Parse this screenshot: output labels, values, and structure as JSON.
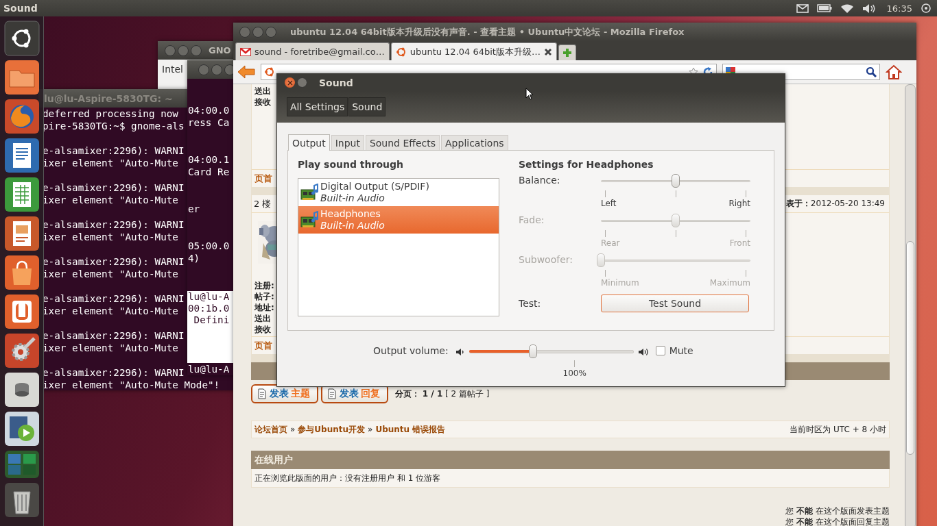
{
  "top_panel": {
    "app_title": "Sound",
    "clock": "16:35"
  },
  "launcher": [
    {
      "kind": "dash"
    },
    {
      "kind": "folder"
    },
    {
      "kind": "browser"
    },
    {
      "kind": "writer"
    },
    {
      "kind": "calc"
    },
    {
      "kind": "impress"
    },
    {
      "kind": "store"
    },
    {
      "kind": "cloud"
    },
    {
      "kind": "settings"
    },
    {
      "kind": "disk"
    },
    {
      "kind": "video"
    },
    {
      "kind": "workspaces"
    },
    {
      "kind": "trash"
    }
  ],
  "gnome_window": {
    "title": "GNO",
    "lines": [
      "Intel"
    ]
  },
  "terminal": {
    "title": "lu@lu-Aspire-5830TG: ~",
    "groups": [
      [
        "deferred processing now",
        "pire-5830TG:~$ gnome-als"
      ],
      [
        "e-alsamixer:2296): WARNI",
        "ixer element \"Auto-Mute"
      ],
      [
        "e-alsamixer:2296): WARNI",
        "ixer element \"Auto-Mute"
      ],
      [
        "e-alsamixer:2296): WARNI",
        "ixer element \"Auto-Mute"
      ],
      [
        "e-alsamixer:2296): WARNI",
        "ixer element \"Auto-Mute"
      ],
      [
        "e-alsamixer:2296): WARNI",
        "ixer element \"Auto-Mute"
      ],
      [
        "e-alsamixer:2296): WARNI",
        "ixer element \"Auto-Mute"
      ],
      [
        "e-alsamixer:2296): WARNI",
        "ixer element \"Auto-Mute Mode\"!"
      ]
    ]
  },
  "second_terminal": {
    "blocks": [
      {
        "kind": "dark",
        "groups": [
          [
            "04:00.0",
            "ress Ca"
          ],
          [
            "04:00.1",
            "Card Re"
          ],
          [
            "er"
          ],
          [
            "05:00.0",
            "4)"
          ]
        ]
      },
      {
        "kind": "light",
        "groups": [
          [
            "lu@lu-A",
            "00:1b.0",
            " Defini"
          ]
        ]
      },
      {
        "kind": "dark",
        "groups": [
          [
            "lu@lu-A"
          ]
        ]
      }
    ]
  },
  "browser": {
    "title": "ubuntu 12.04 64bit版本升级后没有声音. - 查看主题 • Ubuntu中文论坛 - Mozilla Firefox",
    "tabs": [
      {
        "label": "sound - foretribe@gmail.co…",
        "kind": "mail",
        "selected": false
      },
      {
        "label": "ubuntu 12.04 64bit版本升级…",
        "kind": "site",
        "selected": true
      }
    ],
    "search": {
      "kind": "web"
    }
  },
  "forum": {
    "post_top": {
      "labels": [
        "送出",
        "接收"
      ],
      "top_link": "页首"
    },
    "post": {
      "number": "2 楼",
      "posted": "**表于：**2012-05-20 13:49",
      "labels": [
        "注册:",
        "帖子:",
        "地址:",
        "送出",
        "接收"
      ],
      "top_link": "页首"
    },
    "actions": [
      {
        "lead": "发表",
        "accent": "主题"
      },
      {
        "lead": "发表",
        "accent": "回复"
      }
    ],
    "pagination": "**分页：** **1 / 1**  [ 2 篇帖子 ]",
    "breadcrumb": [
      {
        "kind": "link",
        "text": "论坛首页"
      },
      {
        "kind": "separator",
        "text": "»"
      },
      {
        "kind": "link",
        "text": "参与Ubuntu开发"
      },
      {
        "kind": "separator",
        "text": "»"
      },
      {
        "kind": "link",
        "text": "Ubuntu 错误报告"
      }
    ],
    "timezone": "当前时区为 UTC + 8 小时",
    "online": {
      "heading": "在线用户",
      "text": "正在浏览此版面的用户：没有注册用户 和 1 位游客"
    },
    "permissions": [
      "您 **不能** 在这个版面发表主题",
      "您 **不能** 在这个版面回复主题"
    ]
  },
  "sound_dialog": {
    "title": "Sound",
    "path": [
      "All Settings",
      "Sound"
    ],
    "tabs": [
      {
        "label": "Output",
        "selected": true
      },
      {
        "label": "Input",
        "selected": false
      },
      {
        "label": "Sound Effects",
        "selected": false
      },
      {
        "label": "Applications",
        "selected": false
      }
    ],
    "device_heading": "Play sound through",
    "devices": [
      {
        "name": "Digital Output (S/PDIF)",
        "detail": "Built-in Audio",
        "selected": false
      },
      {
        "name": "Headphones",
        "detail": "Built-in Audio",
        "selected": true
      }
    ],
    "settings_heading": "Settings for Headphones",
    "sliders": [
      {
        "label": "Balance:",
        "min_label": "Left",
        "max_label": "Right",
        "level": 0.5,
        "disabled": false,
        "center_tick": true
      },
      {
        "label": "Fade:",
        "min_label": "Rear",
        "max_label": "Front",
        "level": 0.5,
        "disabled": true,
        "center_tick": true
      },
      {
        "label": "Subwoofer:",
        "min_label": "Minimum",
        "max_label": "Maximum",
        "level": 0,
        "disabled": true,
        "center_tick": false
      }
    ],
    "test_label": "Test:",
    "test_button": "Test Sound",
    "volume": {
      "label": "Output volume:",
      "level": 0.39,
      "mark": "100%",
      "mute_label": "Mute",
      "muted": false
    }
  }
}
